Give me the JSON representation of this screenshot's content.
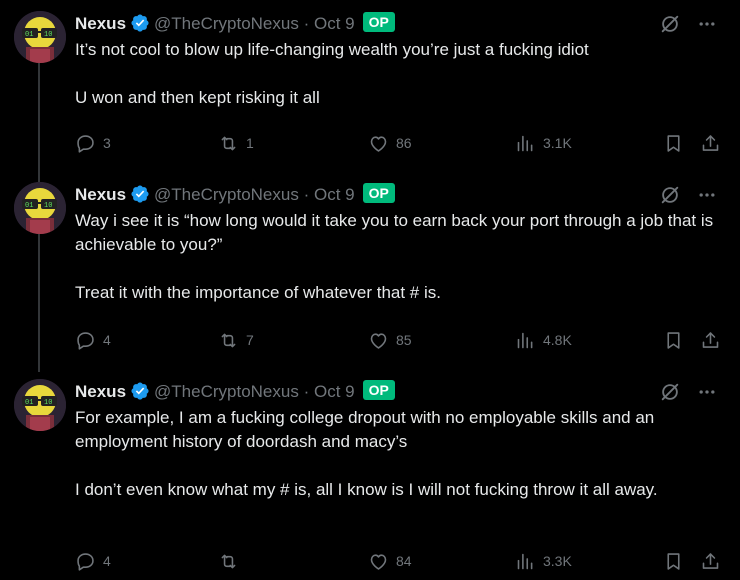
{
  "colors": {
    "background": "#000000",
    "text": "#e7e9ea",
    "muted": "#71767b",
    "verified": "#1d9bf0",
    "op_badge": "#00ba7c",
    "thread_line": "#333639"
  },
  "icons": {
    "verified": "verified-badge-icon",
    "grok": "grok-icon",
    "more": "more-icon",
    "reply": "reply-icon",
    "repost": "repost-icon",
    "like": "like-icon",
    "views": "views-icon",
    "bookmark": "bookmark-icon",
    "share": "share-icon"
  },
  "tweets": [
    {
      "name": "Nexus",
      "handle": "@TheCryptoNexus",
      "separator": "·",
      "date": "Oct 9",
      "badge": "OP",
      "paragraphs": [
        "It’s not cool to blow up life-changing wealth you’re just a fucking idiot",
        "U won and then kept risking it all"
      ],
      "replies": "3",
      "reposts": "1",
      "likes": "86",
      "views": "3.1K"
    },
    {
      "name": "Nexus",
      "handle": "@TheCryptoNexus",
      "separator": "·",
      "date": "Oct 9",
      "badge": "OP",
      "paragraphs": [
        "Way i see it is “how long would it take you to earn back your port through a job that is achievable to you?”",
        "Treat it with the importance of whatever that # is."
      ],
      "replies": "4",
      "reposts": "7",
      "likes": "85",
      "views": "4.8K"
    },
    {
      "name": "Nexus",
      "handle": "@TheCryptoNexus",
      "separator": "·",
      "date": "Oct 9",
      "badge": "OP",
      "paragraphs": [
        "For example, I am a fucking college dropout with no employable skills and an employment history of doordash and macy’s",
        "I don’t even know what my # is, all I know is I will not fucking throw it all away."
      ],
      "replies": "4",
      "reposts": "",
      "likes": "84",
      "views": "3.3K"
    }
  ]
}
